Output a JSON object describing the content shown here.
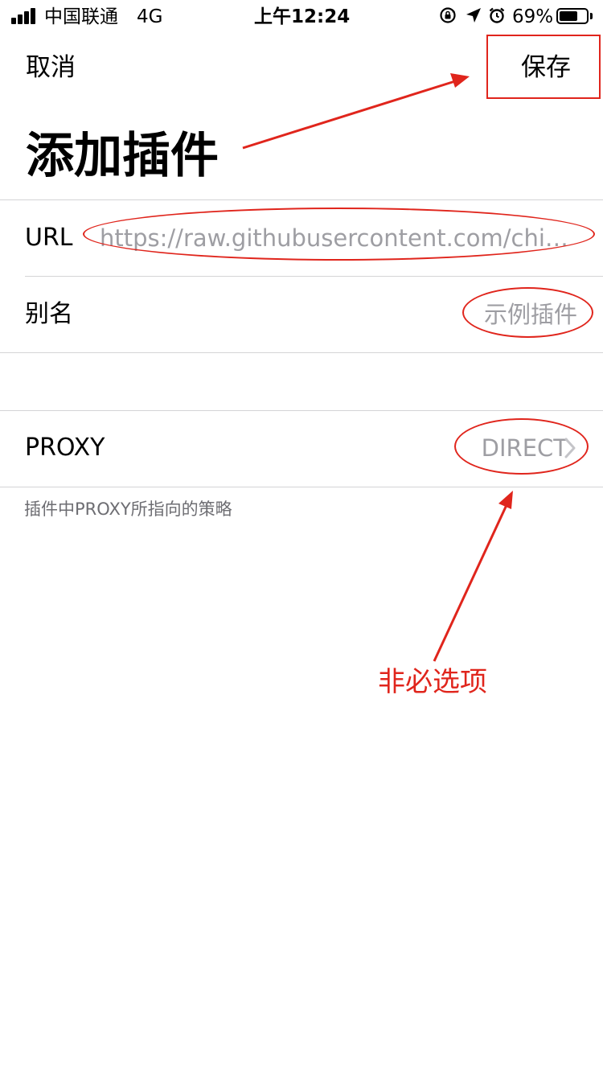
{
  "status_bar": {
    "carrier": "中国联通",
    "network": "4G",
    "time": "上午12:24",
    "battery_percent": "69%",
    "battery_level": 0.69,
    "icons": [
      "signal-icon",
      "rotation-lock-icon",
      "location-arrow-icon",
      "alarm-icon",
      "battery-icon"
    ]
  },
  "nav": {
    "cancel_label": "取消",
    "save_label": "保存"
  },
  "title": "添加插件",
  "form": {
    "url": {
      "label": "URL",
      "placeholder": "https://raw.githubusercontent.com/chiupa…"
    },
    "alias": {
      "label": "别名",
      "placeholder": "示例插件"
    },
    "proxy": {
      "label": "PROXY",
      "value": "DIRECT",
      "icon": "chevron-right-icon",
      "footnote": "插件中PROXY所指向的策略"
    }
  },
  "annotations": {
    "note": "非必选项",
    "color": "#e0251c"
  },
  "colors": {
    "separator": "#d4d4d6",
    "placeholder": "#9e9ea3",
    "footnote": "#6d6d72"
  }
}
